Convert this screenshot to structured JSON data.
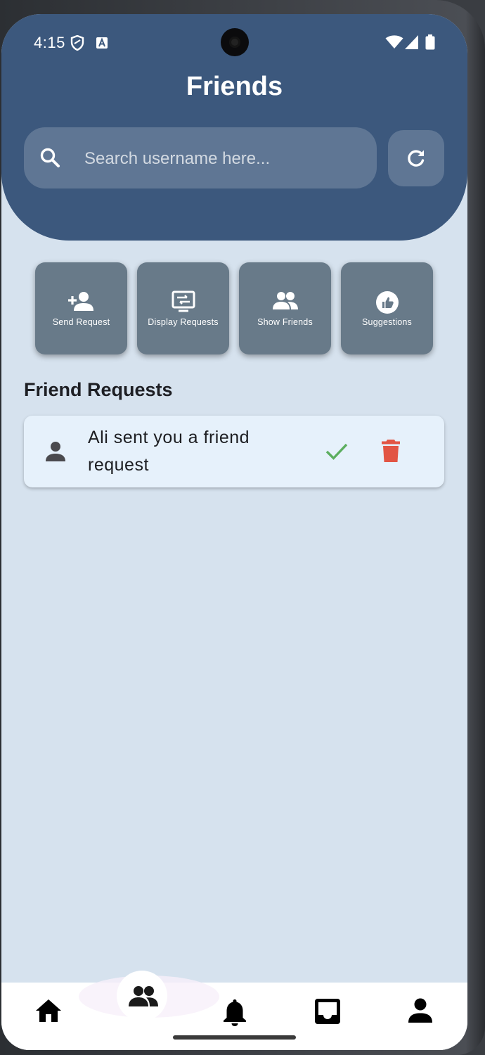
{
  "status_bar": {
    "time": "4:15",
    "icons": [
      "shield-icon",
      "a-icon",
      "wifi-icon",
      "signal-icon",
      "battery-icon"
    ]
  },
  "header": {
    "title": "Friends",
    "search_placeholder": "Search username here...",
    "search_value": "",
    "refresh_icon": "refresh-icon"
  },
  "actions": [
    {
      "label": "Send Request",
      "icon": "person-add-icon"
    },
    {
      "label": "Display Requests",
      "icon": "display-requests-icon"
    },
    {
      "label": "Show Friends",
      "icon": "people-icon"
    },
    {
      "label": "Suggestions",
      "icon": "thumb-up-icon"
    }
  ],
  "friend_requests": {
    "title": "Friend Requests",
    "items": [
      {
        "text": "Ali sent you a friend request",
        "accept_icon": "check-icon",
        "delete_icon": "trash-icon"
      }
    ]
  },
  "bottom_nav": {
    "items": [
      "home-icon",
      "people-icon",
      "bell-icon",
      "inbox-icon",
      "profile-icon"
    ],
    "active": "people-icon"
  },
  "colors": {
    "header": "#3c587d",
    "background": "#d6e2ee",
    "tile": "#687a89",
    "accept": "#5cae5f",
    "delete": "#e25544"
  }
}
